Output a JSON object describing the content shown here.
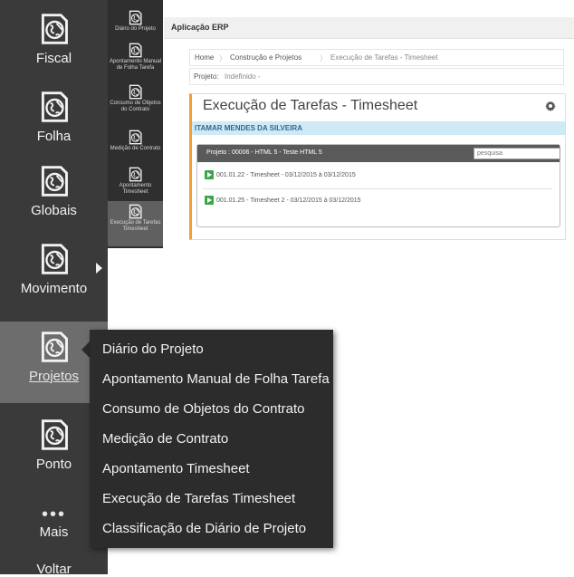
{
  "sidebar": {
    "items": [
      {
        "label": "Fiscal"
      },
      {
        "label": "Folha"
      },
      {
        "label": "Globais"
      },
      {
        "label": "Movimento"
      },
      {
        "label": "Projetos"
      },
      {
        "label": "Ponto"
      },
      {
        "label": "Mais"
      },
      {
        "label": "Voltar"
      }
    ]
  },
  "submenu_strip": {
    "items": [
      {
        "label": "Diário do Projeto"
      },
      {
        "label": "Apontamento Manual de Folha Tarefa"
      },
      {
        "label": "Consumo de Objetos do Contrato"
      },
      {
        "label": "Medição de Contrato"
      },
      {
        "label": "Apontamento Timesheet"
      },
      {
        "label": "Execução de Tarefas Timesheet"
      }
    ]
  },
  "app": {
    "title": "Aplicação ERP"
  },
  "breadcrumb": {
    "home": "Home",
    "sep1": "〉",
    "level1": "Construção e Projetos",
    "sep2": "〉",
    "current": "Execução de Tarefas - Timesheet"
  },
  "project_line": {
    "label": "Projeto:",
    "value": "Indefinido -"
  },
  "card": {
    "title": "Execução de Tarefas - Timesheet",
    "user": "ITAMAR MENDES DA SILVEIRA",
    "project_header": "Projeto : 00006 - HTML 5 - Teste HTML 5",
    "search_placeholder": "pesquisa",
    "tasks": [
      {
        "text": "001.01.22 - Timesheet - 03/12/2015 à 03/12/2015"
      },
      {
        "text": "001.01.25 - Timesheet 2 - 03/12/2015 à 03/12/2015"
      }
    ]
  },
  "dropdown": {
    "items": [
      {
        "label": "Diário do Projeto"
      },
      {
        "label": "Apontamento Manual de Folha Tarefa"
      },
      {
        "label": "Consumo de Objetos do Contrato"
      },
      {
        "label": "Medição de Contrato"
      },
      {
        "label": "Apontamento Timesheet"
      },
      {
        "label": "Execução de Tarefas Timesheet"
      },
      {
        "label": "Classificação de Diário de Projeto"
      }
    ]
  },
  "icons": {
    "module": "globe-document-icon",
    "gear": "gear-icon",
    "play": "play-icon",
    "expand": "chevron-right-icon",
    "more": "ellipsis-icon"
  },
  "colors": {
    "sidebar": "#3a3a3a",
    "active": "#6d6d6d",
    "menu": "#2c2c2c",
    "accent": "#f0a030",
    "user_bar": "#cfe9f6",
    "play": "#3aa648"
  }
}
